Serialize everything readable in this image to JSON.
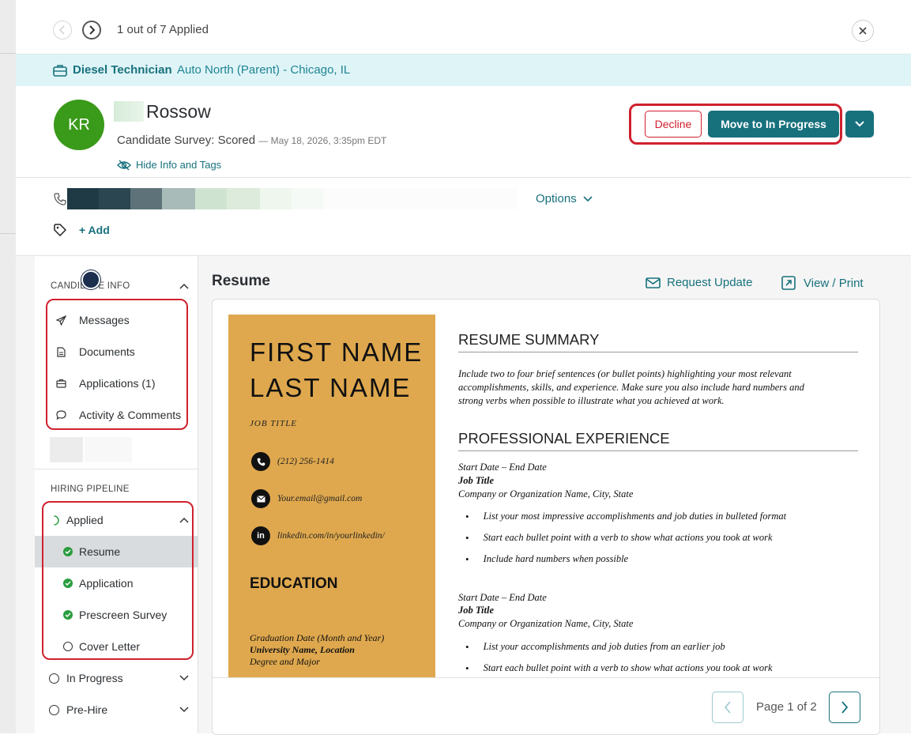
{
  "topbar": {
    "counter": "1 out of 7 Applied"
  },
  "job": {
    "title": "Diesel Technician",
    "location": "Auto North (Parent) - Chicago, IL"
  },
  "candidate": {
    "initials": "KR",
    "last_name": "Rossow",
    "survey_status": "Candidate Survey: Scored",
    "survey_date": "— May 18, 2026, 3:35pm EDT",
    "hide_info_label": "Hide Info and Tags"
  },
  "actions": {
    "decline_label": "Decline",
    "move_label": "Move to In Progress"
  },
  "contact": {
    "options_label": "Options",
    "add_tag_label": "+ Add"
  },
  "sidebar": {
    "candidate_info_label": "CANDIDATE INFO",
    "info_items": [
      {
        "label": "Messages"
      },
      {
        "label": "Documents"
      },
      {
        "label": "Applications (1)"
      },
      {
        "label": "Activity & Comments"
      }
    ],
    "hiring_pipeline_label": "HIRING PIPELINE",
    "stages": {
      "applied": "Applied",
      "applied_steps": [
        {
          "label": "Resume",
          "done": true
        },
        {
          "label": "Application",
          "done": true
        },
        {
          "label": "Prescreen Survey",
          "done": true
        },
        {
          "label": "Cover Letter",
          "done": false
        }
      ],
      "in_progress": "In Progress",
      "pre_hire": "Pre-Hire"
    }
  },
  "main": {
    "heading": "Resume",
    "request_update_label": "Request Update",
    "view_print_label": "View / Print",
    "pager_text": "Page 1 of 2"
  },
  "resume_doc": {
    "first_name": "FIRST NAME",
    "last_name": "LAST NAME",
    "job_title": "JOB TITLE",
    "phone": "(212) 256-1414",
    "email": "Your.email@gmail.com",
    "linkedin": "linkedin.com/in/yourlinkedin/",
    "education_heading": "EDUCATION",
    "edu_date": "Graduation Date (Month and Year)",
    "edu_school": "University Name, Location",
    "edu_degree": "Degree and Major",
    "summary_heading": "RESUME SUMMARY",
    "summary_lines": [
      "Include two to four brief sentences (or bullet points) highlighting your most relevant",
      "accomplishments, skills, and experience. Make sure you also include hard numbers and",
      "strong verbs when possible to illustrate what you achieved at work."
    ],
    "experience_heading": "PROFESSIONAL EXPERIENCE",
    "jobs": [
      {
        "dates": "Start Date – End Date",
        "title": "Job Title",
        "company": "Company or Organization Name, City, State",
        "bullets": [
          "List your most impressive accomplishments and job duties in bulleted format",
          "Start each bullet point with a verb to show what actions you took at work",
          "Include hard numbers when possible"
        ]
      },
      {
        "dates": "Start Date – End Date",
        "title": "Job Title",
        "company": "Company or Organization Name, City, State",
        "bullets": [
          "List your accomplishments and job duties from an earlier job",
          "Start each bullet point with a verb to show what actions you took at work"
        ]
      }
    ]
  }
}
